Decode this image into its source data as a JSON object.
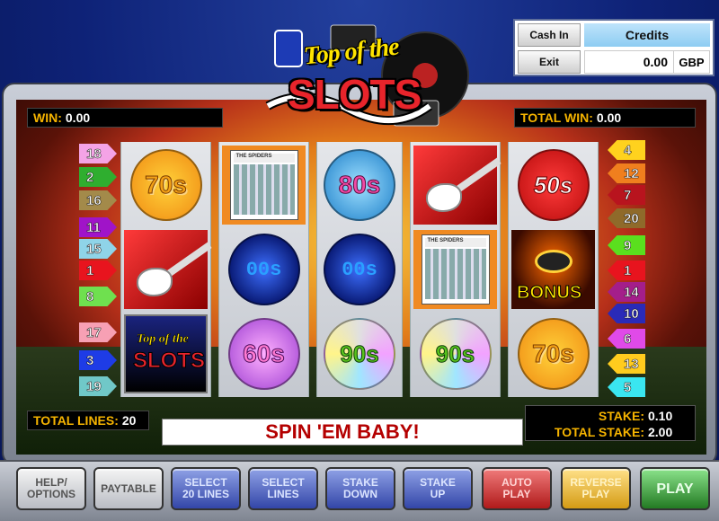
{
  "credits_panel": {
    "cash_in_label": "Cash In",
    "exit_label": "Exit",
    "credits_label": "Credits",
    "credits_value": "0.00",
    "currency": "GBP"
  },
  "logo": {
    "line1": "Top of the",
    "line2": "SLOTS"
  },
  "win": {
    "label": "WIN:",
    "value": "0.00"
  },
  "total_win": {
    "label": "TOTAL WIN:",
    "value": "0.00"
  },
  "total_lines": {
    "label": "TOTAL LINES:",
    "value": "20"
  },
  "stake": {
    "label": "STAKE:",
    "value": "0.10"
  },
  "total_stake": {
    "label": "TOTAL STAKE:",
    "value": "2.00"
  },
  "message": "SPIN 'EM BABY!",
  "left_markers": [
    {
      "n": "18",
      "color": "#f4a3e6"
    },
    {
      "n": "2",
      "color": "#2fae2f"
    },
    {
      "n": "16",
      "color": "#a38a4a"
    },
    {
      "n": "11",
      "color": "#a014c8"
    },
    {
      "n": "15",
      "color": "#8fd4e8"
    },
    {
      "n": "1",
      "color": "#e8141e"
    },
    {
      "n": "8",
      "color": "#6fe04f"
    },
    {
      "n": "17",
      "color": "#f7a0b4"
    },
    {
      "n": "3",
      "color": "#1e3ce6"
    },
    {
      "n": "19",
      "color": "#70c8c8"
    }
  ],
  "right_markers": [
    {
      "n": "4",
      "color": "#ffd21e"
    },
    {
      "n": "12",
      "color": "#f07f1e"
    },
    {
      "n": "7",
      "color": "#b8141e"
    },
    {
      "n": "20",
      "color": "#8f6a2a"
    },
    {
      "n": "9",
      "color": "#5adf1e"
    },
    {
      "n": "1",
      "color": "#e8141e"
    },
    {
      "n": "14",
      "color": "#a41e8a"
    },
    {
      "n": "10",
      "color": "#2a2ab8"
    },
    {
      "n": "6",
      "color": "#e04ae8"
    },
    {
      "n": "13",
      "color": "#ffcc1e"
    },
    {
      "n": "5",
      "color": "#3ae6f0"
    }
  ],
  "reels": [
    [
      {
        "type": "disc",
        "cls": "s70",
        "text": "70s"
      },
      {
        "type": "guitar"
      },
      {
        "type": "logo",
        "t1": "Top of the",
        "t2": "SLOTS"
      }
    ],
    [
      {
        "type": "album",
        "text": "THE SPIDERS"
      },
      {
        "type": "disc",
        "cls": "s00",
        "text": "00s"
      },
      {
        "type": "disc",
        "cls": "s60",
        "text": "60s"
      }
    ],
    [
      {
        "type": "disc",
        "cls": "s80",
        "text": "80s"
      },
      {
        "type": "disc",
        "cls": "s00",
        "text": "00s"
      },
      {
        "type": "disc",
        "cls": "s90",
        "text": "90s"
      }
    ],
    [
      {
        "type": "guitar"
      },
      {
        "type": "album",
        "text": "THE SPIDERS"
      },
      {
        "type": "disc",
        "cls": "s90",
        "text": "90s"
      }
    ],
    [
      {
        "type": "disc",
        "cls": "s50",
        "text": "50s"
      },
      {
        "type": "bonus",
        "text": "BONUS"
      },
      {
        "type": "disc",
        "cls": "s70",
        "text": "70s"
      }
    ]
  ],
  "buttons": [
    {
      "name": "help-options-button",
      "label": "HELP/\nOPTIONS",
      "style": "b-grey"
    },
    {
      "name": "paytable-button",
      "label": "PAYTABLE",
      "style": "b-grey"
    },
    {
      "name": "select-20-lines-button",
      "label": "SELECT\n20 LINES",
      "style": "b-blue"
    },
    {
      "name": "select-lines-button",
      "label": "SELECT\nLINES",
      "style": "b-blue"
    },
    {
      "name": "stake-down-button",
      "label": "STAKE\nDOWN",
      "style": "b-blue"
    },
    {
      "name": "stake-up-button",
      "label": "STAKE\nUP",
      "style": "b-blue"
    },
    {
      "name": "auto-play-button",
      "label": "AUTO\nPLAY",
      "style": "b-red"
    },
    {
      "name": "reverse-play-button",
      "label": "REVERSE\nPLAY",
      "style": "b-gold"
    },
    {
      "name": "play-button",
      "label": "PLAY",
      "style": "b-green"
    }
  ]
}
